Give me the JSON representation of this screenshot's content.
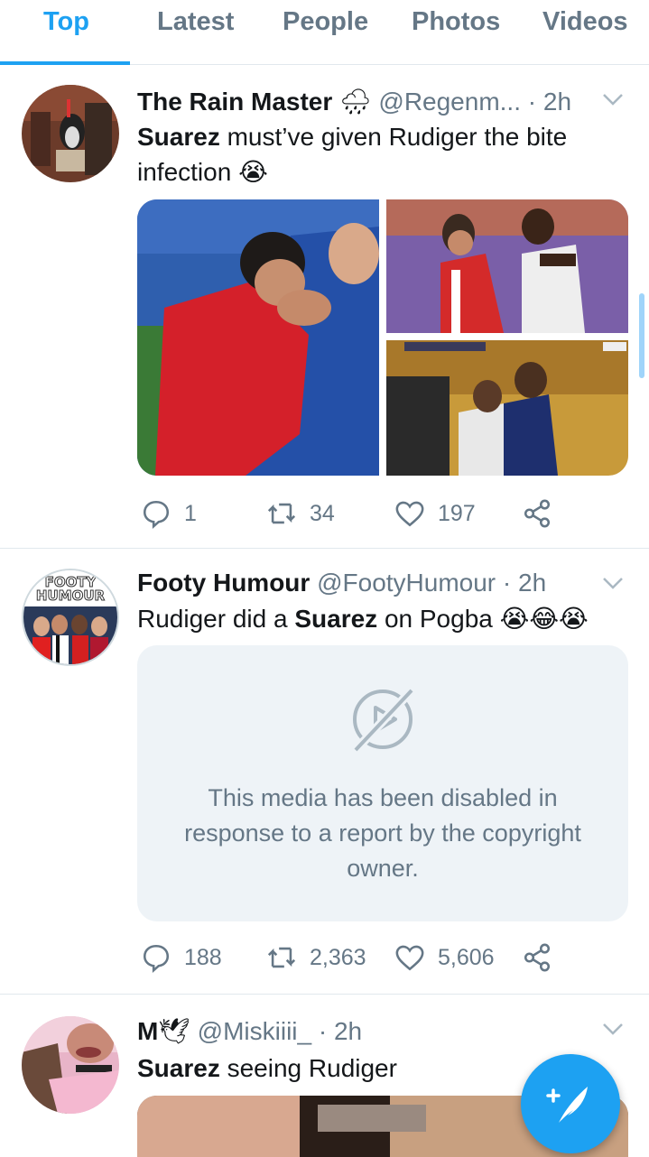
{
  "tabs": [
    {
      "label": "Top",
      "active": true
    },
    {
      "label": "Latest",
      "active": false
    },
    {
      "label": "People",
      "active": false
    },
    {
      "label": "Photos",
      "active": false
    },
    {
      "label": "Videos",
      "active": false
    }
  ],
  "colors": {
    "accent": "#1da1f2",
    "secondary_text": "#657786",
    "divider": "#e1e8ed"
  },
  "tweets": [
    {
      "name": "The Rain Master",
      "name_emoji": "🌧",
      "handle": "@Regenm...",
      "time": "· 2h",
      "text_bold": "Suarez",
      "text_rest": " must’ve given Rudiger the bite infection",
      "text_emoji": "😭",
      "replies": "1",
      "retweets": "34",
      "likes": "197"
    },
    {
      "name": "Footy Humour",
      "handle": "@FootyHumour",
      "time": "· 2h",
      "text_pre": "Rudiger did a ",
      "text_bold": "Suarez",
      "text_post": " on Pogba ",
      "text_emoji": "😭😂😭",
      "avatar_text": [
        "FOOTY",
        "HUMOUR"
      ],
      "media_disabled_message": "This media has been disabled in response to a report by the copyright owner.",
      "replies": "188",
      "retweets": "2,363",
      "likes": "5,606"
    },
    {
      "name": "M",
      "name_emoji": "🕊",
      "handle": "@Miskiiii_",
      "time": "· 2h",
      "text_bold": "Suarez",
      "text_rest": " seeing Rudiger"
    }
  ],
  "icons": {
    "reply": "reply-icon",
    "retweet": "retweet-icon",
    "like": "heart-icon",
    "share": "share-icon",
    "more": "chevron-down-icon",
    "compose": "compose-tweet-icon",
    "media_disabled": "video-disabled-icon"
  }
}
